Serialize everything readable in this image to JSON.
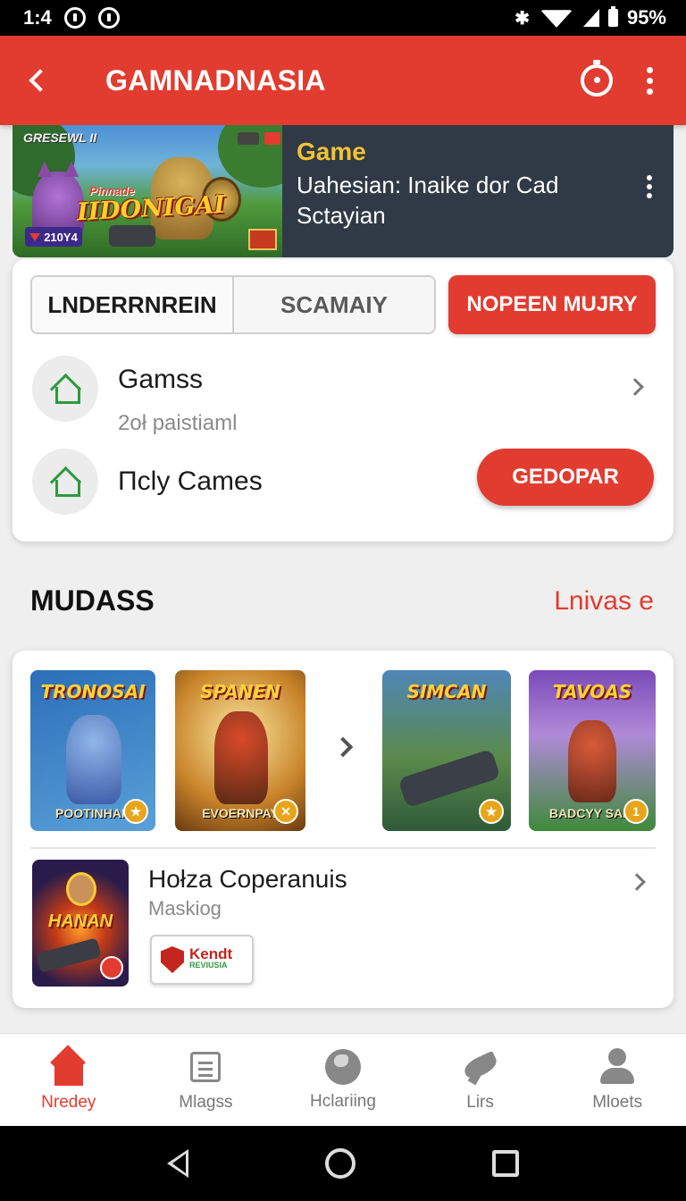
{
  "status_bar": {
    "time": "1:4",
    "battery": "95%"
  },
  "app_bar": {
    "title": "GAMNADNASIA"
  },
  "banner": {
    "art_top_text": "GRESEWL II",
    "art_logo_sub": "Pinnade",
    "art_logo": "IIDONIGAI",
    "art_price": "210Y4",
    "kicker": "Game",
    "description": "Uahesian: Inaike dor Cad Sctayian"
  },
  "segment": {
    "tab1": "LNDERRNREIN",
    "tab2": "SCAMAIY"
  },
  "primary_button": "NOPEEN MUJRY",
  "list": {
    "item1_title": "Gamss",
    "item1_sub": "2oł paistiaml",
    "item2_title": "Πcly Cames",
    "item2_button": "GEDOPAR"
  },
  "section": {
    "title": "MUDASS",
    "link": "Lnivas e"
  },
  "carousel": [
    {
      "title": "TRONOSAI",
      "footer": "POOTINHAN",
      "colors": [
        "#2a6fb8",
        "#5aa0d8"
      ]
    },
    {
      "title": "SPANEN",
      "footer": "EVOERNPAY",
      "colors": [
        "#f3c45a",
        "#8a4a14"
      ]
    },
    {
      "title": "SIMCAN",
      "footer": "",
      "colors": [
        "#4f86b8",
        "#2f5a3a"
      ]
    },
    {
      "title": "TAVOAS",
      "footer": "BADCYY SAHI",
      "colors": [
        "#7a4ab8",
        "#3f8a3a"
      ]
    }
  ],
  "featured": {
    "thumb_title": "HANAN",
    "title": "Hołza Coperanuis",
    "subtitle": "Maskiog",
    "chip_main": "Kendt",
    "chip_sub": "REVIUSIA"
  },
  "bottom_nav": [
    {
      "label": "Nredey",
      "icon": "home-icon"
    },
    {
      "label": "Mlagss",
      "icon": "messages-icon"
    },
    {
      "label": "Hclariing",
      "icon": "globe-icon"
    },
    {
      "label": "Lirs",
      "icon": "bird-icon"
    },
    {
      "label": "Mloets",
      "icon": "user-icon"
    }
  ],
  "theme": {
    "accent": "#e23c30",
    "green": "#2e9a3e"
  }
}
